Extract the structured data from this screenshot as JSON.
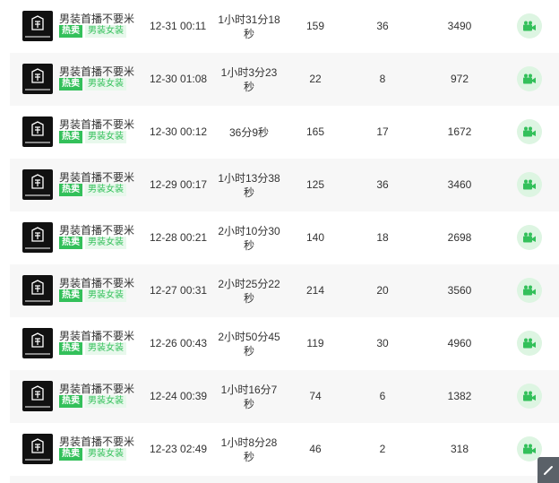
{
  "colors": {
    "accent": "#33c05a",
    "accent_light": "#ddf5e2",
    "row_alt": "#f7f7f7"
  },
  "rows": [
    {
      "name": "男装首播不要米",
      "hot": "热卖",
      "category": "男装女装",
      "time": "12-31 00:11",
      "duration": "1小时31分18秒",
      "c1": "159",
      "c2": "36",
      "c3": "3490",
      "icon": "video-camera-icon"
    },
    {
      "name": "男装首播不要米",
      "hot": "热卖",
      "category": "男装女装",
      "time": "12-30 01:08",
      "duration": "1小时3分23秒",
      "c1": "22",
      "c2": "8",
      "c3": "972",
      "icon": "video-camera-icon"
    },
    {
      "name": "男装首播不要米",
      "hot": "热卖",
      "category": "男装女装",
      "time": "12-30 00:12",
      "duration": "36分9秒",
      "c1": "165",
      "c2": "17",
      "c3": "1672",
      "icon": "video-camera-icon"
    },
    {
      "name": "男装首播不要米",
      "hot": "热卖",
      "category": "男装女装",
      "time": "12-29 00:17",
      "duration": "1小时13分38秒",
      "c1": "125",
      "c2": "36",
      "c3": "3460",
      "icon": "video-camera-icon"
    },
    {
      "name": "男装首播不要米",
      "hot": "热卖",
      "category": "男装女装",
      "time": "12-28 00:21",
      "duration": "2小时10分30秒",
      "c1": "140",
      "c2": "18",
      "c3": "2698",
      "icon": "video-camera-icon"
    },
    {
      "name": "男装首播不要米",
      "hot": "热卖",
      "category": "男装女装",
      "time": "12-27 00:31",
      "duration": "2小时25分22秒",
      "c1": "214",
      "c2": "20",
      "c3": "3560",
      "icon": "video-camera-icon"
    },
    {
      "name": "男装首播不要米",
      "hot": "热卖",
      "category": "男装女装",
      "time": "12-26 00:43",
      "duration": "2小时50分45秒",
      "c1": "119",
      "c2": "30",
      "c3": "4960",
      "icon": "video-camera-icon"
    },
    {
      "name": "男装首播不要米",
      "hot": "热卖",
      "category": "男装女装",
      "time": "12-24 00:39",
      "duration": "1小时16分7秒",
      "c1": "74",
      "c2": "6",
      "c3": "1382",
      "icon": "video-camera-icon"
    },
    {
      "name": "男装首播不要米",
      "hot": "热卖",
      "category": "男装女装",
      "time": "12-23 02:49",
      "duration": "1小时8分28秒",
      "c1": "46",
      "c2": "2",
      "c3": "318",
      "icon": "video-camera-icon"
    }
  ],
  "scroll_button": {
    "icon": "scroll-to-top-icon"
  }
}
